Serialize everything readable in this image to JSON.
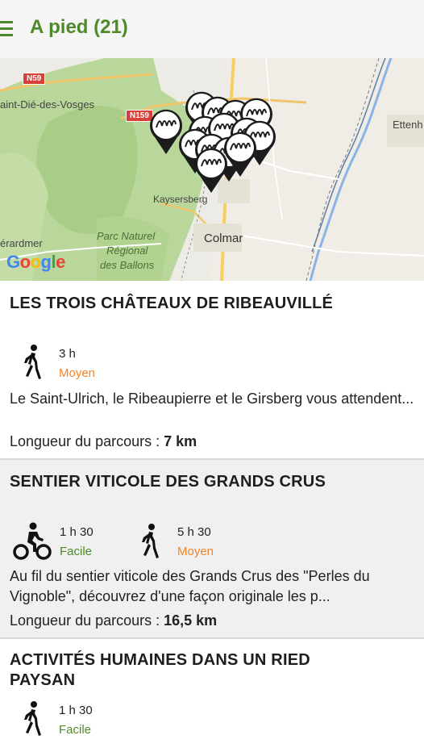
{
  "app": {
    "title": "A pied (21)"
  },
  "colors": {
    "accent": "#4e8a2a",
    "moyen": "#f0852b",
    "facile": "#4e8a2a"
  },
  "map": {
    "labels": {
      "saint_die": "aint-Dié-des-Vosges",
      "kaysersberg": "Kaysersberg",
      "colmar": "Colmar",
      "gerardmer": "érardmer",
      "ettenheim": "Ettenh",
      "parc1": "Parc Naturel",
      "parc2": "Régional",
      "parc3": "des Ballons"
    },
    "roads": {
      "n59": "N59",
      "n159": "N159"
    },
    "logo": "Google"
  },
  "cards": [
    {
      "title": "LES TROIS CHÂTEAUX DE RIBEAUVILLÉ",
      "activities": [
        {
          "icon": "walk-icon",
          "time": "3 h",
          "level": "Moyen"
        }
      ],
      "description": "Le Saint-Ulrich, le Ribeaupierre et le Girsberg vous attendent...",
      "length_label": "Longueur du parcours : ",
      "length_value": "7 km"
    },
    {
      "title": "SENTIER VITICOLE DES GRANDS CRUS",
      "activities": [
        {
          "icon": "bike-icon",
          "time": "1 h 30",
          "level": "Facile"
        },
        {
          "icon": "walk-icon",
          "time": "5 h 30",
          "level": "Moyen"
        }
      ],
      "description": "Au fil du sentier viticole des Grands Crus des \"Perles du Vignoble\", découvrez d'une façon originale les p...",
      "length_label": "Longueur du parcours : ",
      "length_value": "16,5 km"
    },
    {
      "title": "ACTIVITÉS HUMAINES DANS UN RIED PAYSAN",
      "activities": [
        {
          "icon": "walk-icon",
          "time": "1 h 30",
          "level": "Facile"
        }
      ]
    }
  ]
}
